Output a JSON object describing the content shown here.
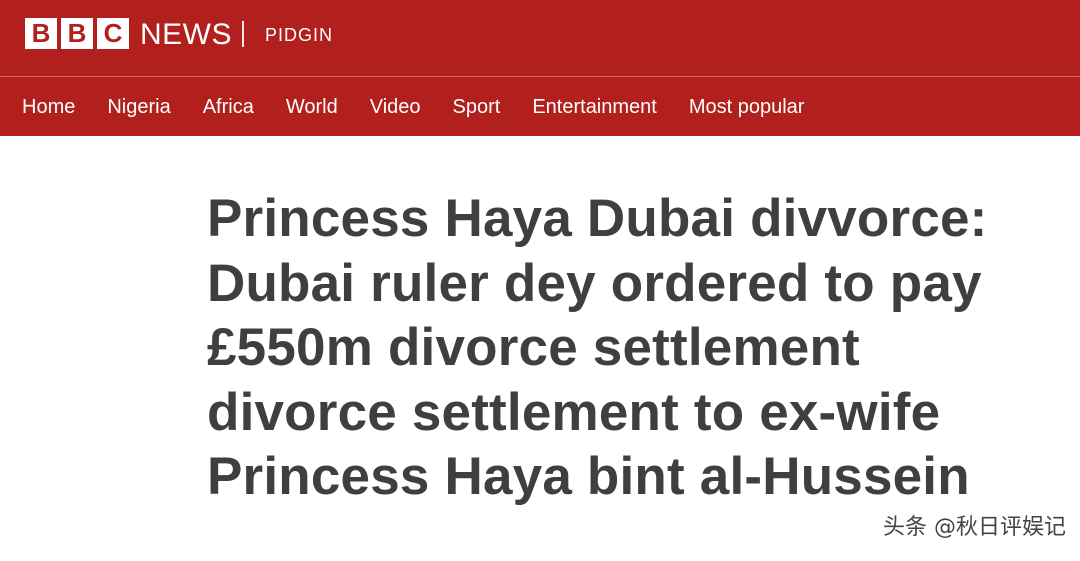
{
  "header": {
    "logo_letters": [
      "B",
      "B",
      "C"
    ],
    "brand": "NEWS",
    "edition": "PIDGIN",
    "colors": {
      "brand_red": "#b1201c",
      "text": "#ffffff"
    }
  },
  "nav": {
    "items": [
      "Home",
      "Nigeria",
      "Africa",
      "World",
      "Video",
      "Sport",
      "Entertainment",
      "Most popular"
    ]
  },
  "article": {
    "headline_lines": [
      "Princess Haya Dubai divvorce:",
      "Dubai ruler dey ordered to pay",
      "£550m divorce settlement",
      "divorce settlement to ex-wife",
      "Princess Haya bint al-Hussein"
    ],
    "headline_color": "#3f3f42"
  },
  "watermark": {
    "text": "头条 @秋日评娱记"
  }
}
